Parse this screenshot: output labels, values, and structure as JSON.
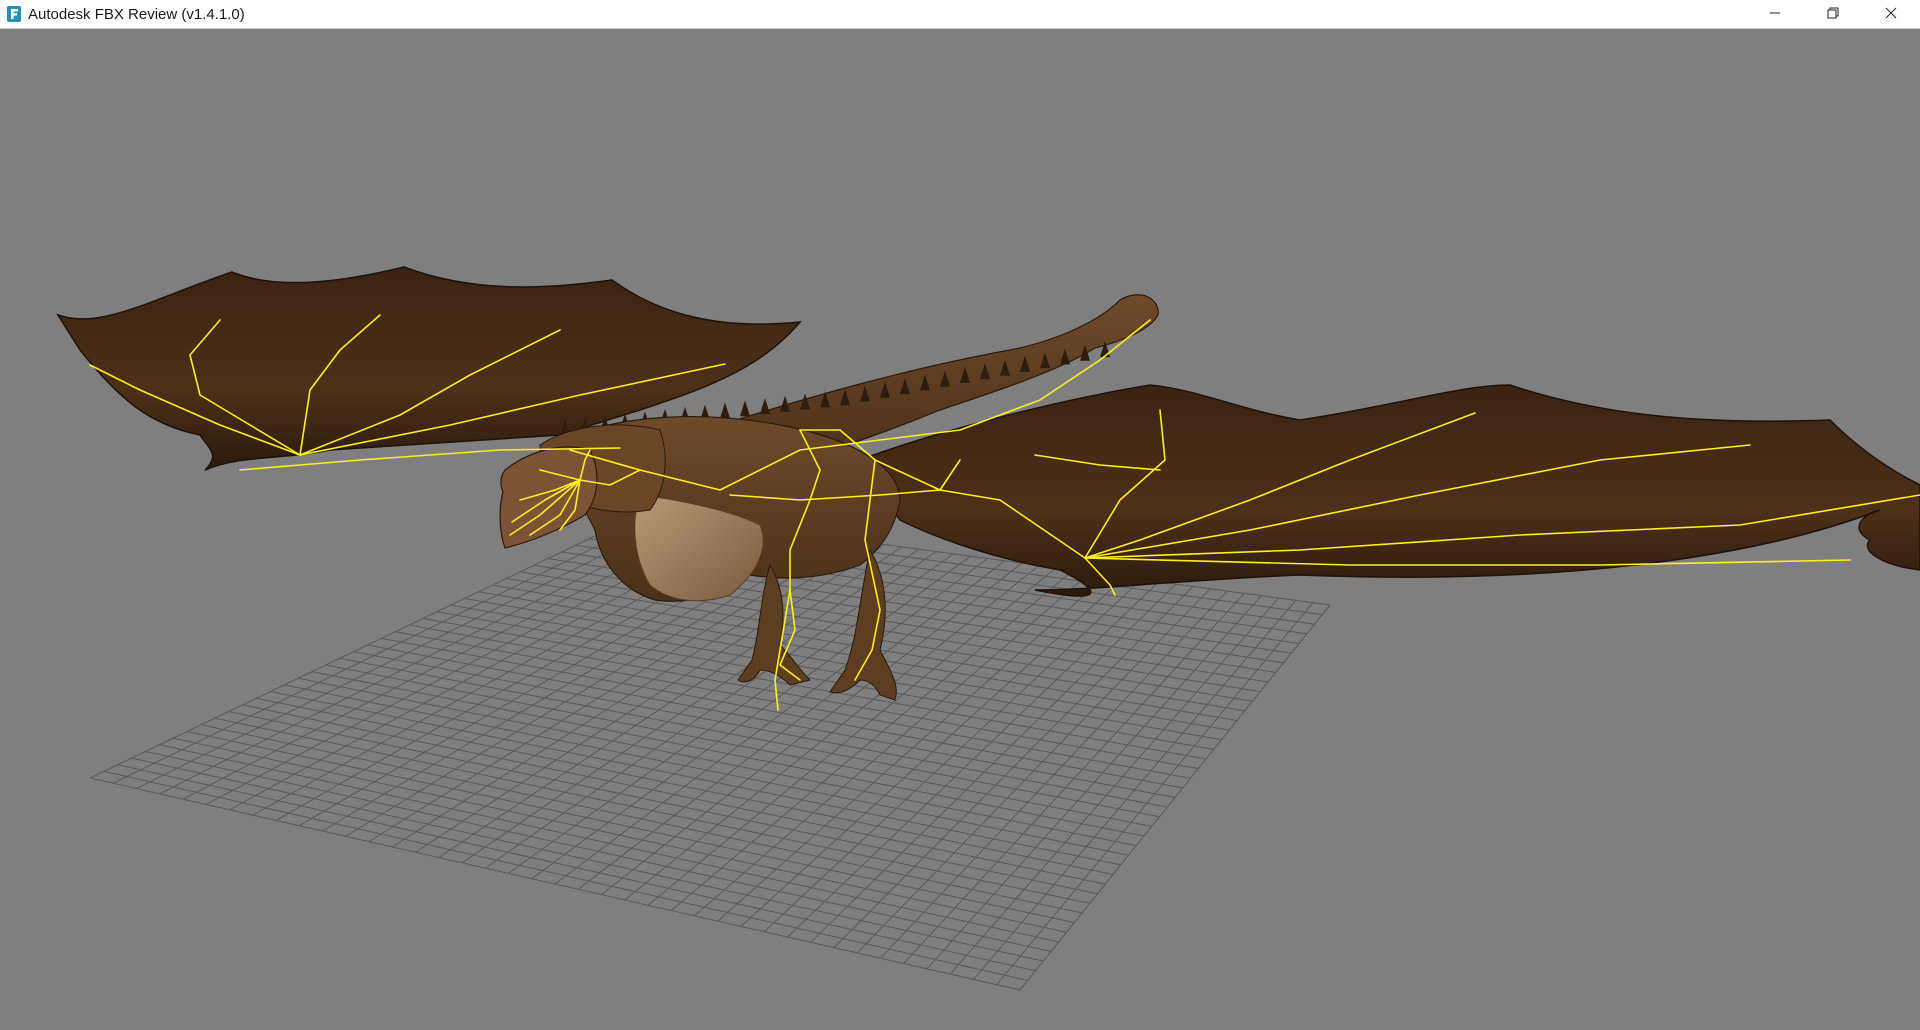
{
  "window": {
    "title": "Autodesk FBX Review (v1.4.1.0)",
    "app_icon": "fbx-review-icon",
    "controls": {
      "minimize_icon": "minimize-icon",
      "restore_icon": "restore-icon",
      "close_icon": "close-icon"
    }
  },
  "viewport": {
    "background_color": "#7f7f7f",
    "grid_color": "#5a5a5a",
    "skeleton_color": "#ffee22",
    "model_color": "#5a3a1e",
    "model": "dragon-model"
  }
}
